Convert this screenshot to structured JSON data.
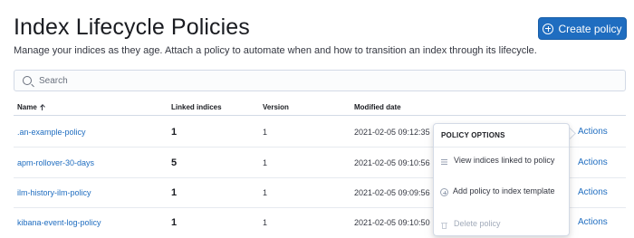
{
  "page": {
    "title": "Index Lifecycle Policies",
    "description": "Manage your indices as they age. Attach a policy to automate when and how to transition an index through its lifecycle.",
    "create_button_label": "Create policy"
  },
  "search": {
    "placeholder": "Search",
    "value": ""
  },
  "table": {
    "columns": {
      "name": "Name",
      "linked": "Linked indices",
      "version": "Version",
      "modified": "Modified date"
    },
    "sort": {
      "column": "Name",
      "direction": "ascending"
    },
    "rows": [
      {
        "name": ".an-example-policy",
        "linked": "1",
        "version": "1",
        "modified": "2021-02-05 09:12:35",
        "actions": "Actions"
      },
      {
        "name": "apm-rollover-30-days",
        "linked": "5",
        "version": "1",
        "modified": "2021-02-05 09:10:56",
        "actions": "Actions"
      },
      {
        "name": "ilm-history-ilm-policy",
        "linked": "1",
        "version": "1",
        "modified": "2021-02-05 09:09:56",
        "actions": "Actions"
      },
      {
        "name": "kibana-event-log-policy",
        "linked": "1",
        "version": "1",
        "modified": "2021-02-05 09:10:50",
        "actions": "Actions"
      }
    ]
  },
  "popover": {
    "title": "POLICY OPTIONS",
    "items": [
      {
        "label": "View indices linked to policy",
        "icon": "list-icon",
        "disabled": false
      },
      {
        "label": "Add policy to index template",
        "icon": "plus-in-circle-icon",
        "disabled": false
      },
      {
        "label": "Delete policy",
        "icon": "trash-icon",
        "disabled": true
      }
    ]
  },
  "colors": {
    "primary": "#1f6dc0",
    "link": "#1f6dc0",
    "text": "#343741",
    "border": "#d3dae6"
  }
}
